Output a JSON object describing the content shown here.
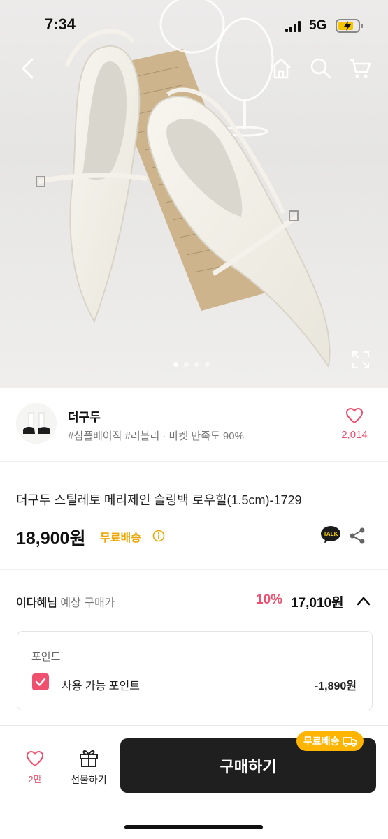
{
  "status_bar": {
    "time": "7:34",
    "network": "5G"
  },
  "header": {
    "icons": [
      "back-arrow-icon",
      "home-icon",
      "search-icon",
      "cart-icon"
    ]
  },
  "gallery": {
    "total_images": 4,
    "active_index": 0,
    "icons": [
      "expand-icon"
    ]
  },
  "store": {
    "name": "더구두",
    "tags": "#심플베이직 #러블리 · 마켓 만족도 90%",
    "like_count": "2,014"
  },
  "product": {
    "title": "더구두 스틸레토 메리제인 슬링백 로우힐(1.5cm)-1729",
    "price": "18,900원",
    "shipping": "무료배송"
  },
  "expected_price": {
    "user": "이다혜님",
    "label": " 예상 구매가",
    "discount": "10%",
    "price": "17,010원"
  },
  "points": {
    "title": "포인트",
    "checkbox_checked": true,
    "label": "사용 가능 포인트",
    "value": "-1,890원"
  },
  "bottom_bar": {
    "like_count": "2만",
    "gift_label": "선물하기",
    "buy_label": "구매하기",
    "ship_badge": "무료배송"
  },
  "colors": {
    "accent": "#f0506e",
    "shipping": "#f0a500",
    "badge": "#ffb400",
    "buy_button": "#1f1f1f"
  }
}
